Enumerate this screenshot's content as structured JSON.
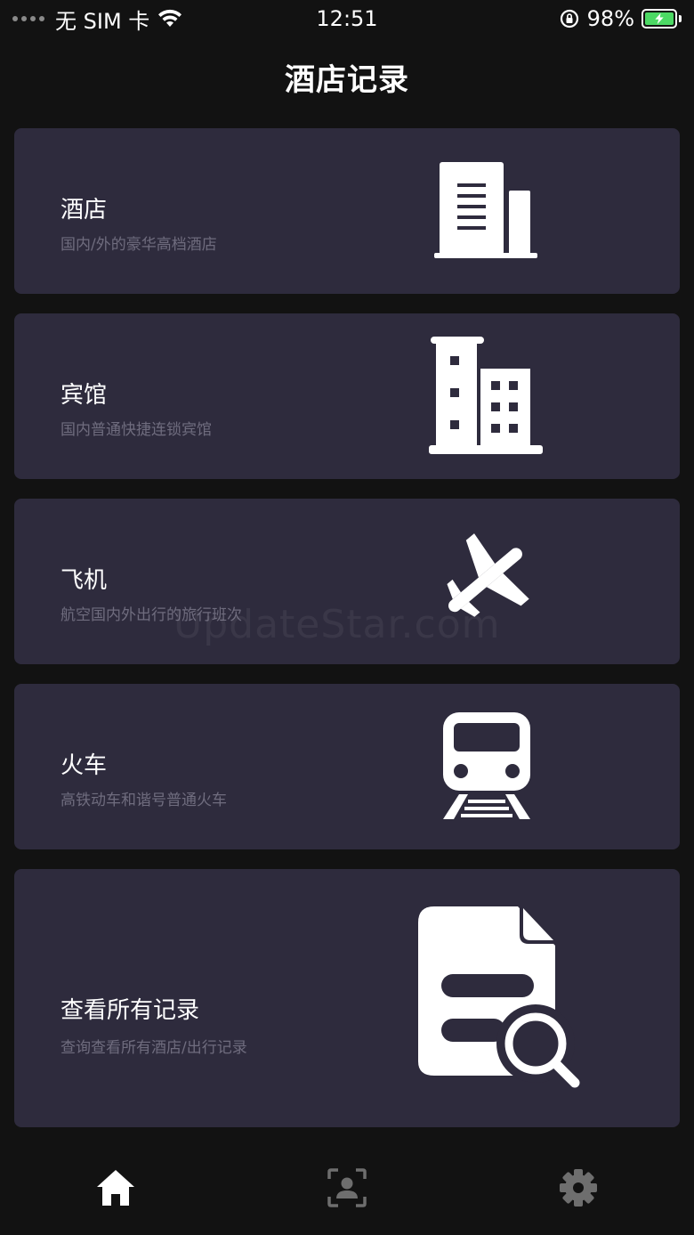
{
  "status_bar": {
    "carrier": "无 SIM 卡",
    "time": "12:51",
    "battery_percent": "98%"
  },
  "header": {
    "title": "酒店记录"
  },
  "cards": [
    {
      "title": "酒店",
      "subtitle": "国内/外的豪华高档酒店",
      "icon": "building-icon"
    },
    {
      "title": "宾馆",
      "subtitle": "国内普通快捷连锁宾馆",
      "icon": "hotel-icon"
    },
    {
      "title": "飞机",
      "subtitle": "航空国内外出行的旅行班次",
      "icon": "airplane-icon"
    },
    {
      "title": "火车",
      "subtitle": "高铁动车和谐号普通火车",
      "icon": "train-icon"
    },
    {
      "title": "查看所有记录",
      "subtitle": "查询查看所有酒店/出行记录",
      "icon": "file-search-icon"
    }
  ],
  "watermark": "UpdateStar.com",
  "tab_bar": {
    "tabs": [
      {
        "icon": "home-icon",
        "active": true
      },
      {
        "icon": "profile-icon",
        "active": false
      },
      {
        "icon": "gear-icon",
        "active": false
      }
    ]
  },
  "colors": {
    "background": "#121212",
    "card": "#2e2b3d",
    "subtitle": "#6f6c7e",
    "tab_inactive": "#6e6e6e",
    "battery": "#4cd964"
  }
}
